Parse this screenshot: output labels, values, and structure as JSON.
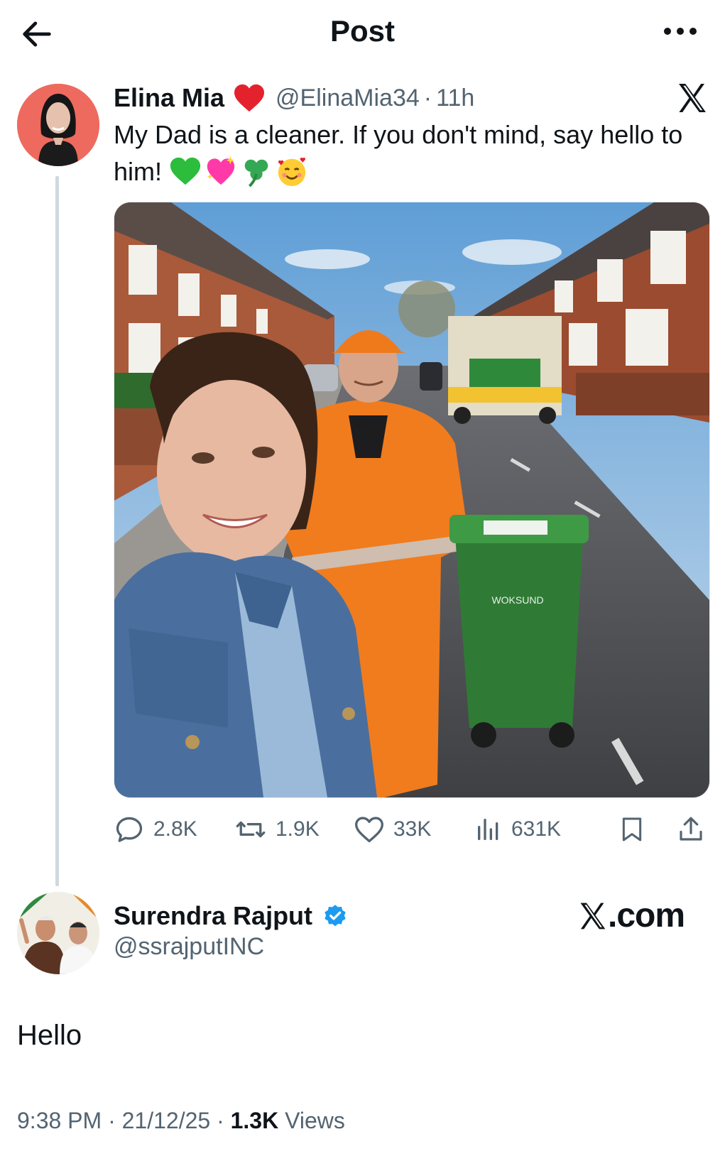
{
  "header": {
    "title": "Post",
    "back_icon": "arrow-left-icon",
    "more_icon": "more-horizontal-icon"
  },
  "post": {
    "author_name": "Elina Mia",
    "handle": "@ElinaMia34",
    "separator": "·",
    "time": "11h",
    "text": "My Dad is a cleaner. If you don't mind, say hello to him!",
    "emojis": [
      "green-heart-icon",
      "sparkling-heart-icon",
      "shamrock-icon",
      "smiling-face-with-hearts-icon"
    ],
    "bin_label": "WOKSUND",
    "actions": {
      "replies": "2.8K",
      "reposts": "1.9K",
      "likes": "33K",
      "views": "631K"
    }
  },
  "reply": {
    "author_name": "Surendra Rajput",
    "handle": "@ssrajputINC",
    "text": "Hello",
    "time": "9:38 PM",
    "date": "21/12/25",
    "separator": "·",
    "views_count": "1.3K",
    "views_label": "Views"
  },
  "watermark": {
    "text": ".com"
  },
  "colors": {
    "accent": "#1d9bf0",
    "secondary_text": "#536471",
    "primary_text": "#0f1419",
    "heart": "#e0245e"
  }
}
